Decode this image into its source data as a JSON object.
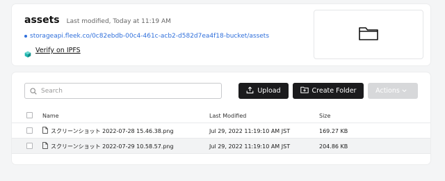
{
  "bucket": {
    "name": "assets",
    "last_modified": "Last modified, Today at 11:19 AM",
    "url": "storageapi.fleek.co/0c82ebdb-00c4-461c-acb2-d582d7ea4f18-bucket/assets",
    "ipfs_link": "Verify on IPFS"
  },
  "toolbar": {
    "search_placeholder": "Search",
    "upload_label": "Upload",
    "create_folder_label": "Create Folder",
    "actions_label": "Actions"
  },
  "table": {
    "headers": {
      "name": "Name",
      "last_modified": "Last Modified",
      "size": "Size"
    },
    "rows": [
      {
        "name": "スクリーンショット 2022-07-28 15.46.38.png",
        "last_modified": "Jul 29, 2022 11:19:10 AM JST",
        "size": "169.27 KB"
      },
      {
        "name": "スクリーンショット 2022-07-29 10.58.57.png",
        "last_modified": "Jul 29, 2022 11:19:10 AM JST",
        "size": "204.86 KB"
      }
    ]
  },
  "colors": {
    "link": "#2f6fdb",
    "dark_button": "#1b1b1d",
    "disabled_button": "#d7d8da",
    "ipfs_cube": "#1fb6b0"
  },
  "icons": {
    "search": "search-icon",
    "upload": "upload-icon",
    "create_folder": "folder-plus-icon",
    "actions": "chevron-down-icon",
    "preview": "folder-icon",
    "file": "file-icon",
    "ipfs": "ipfs-cube-icon"
  }
}
